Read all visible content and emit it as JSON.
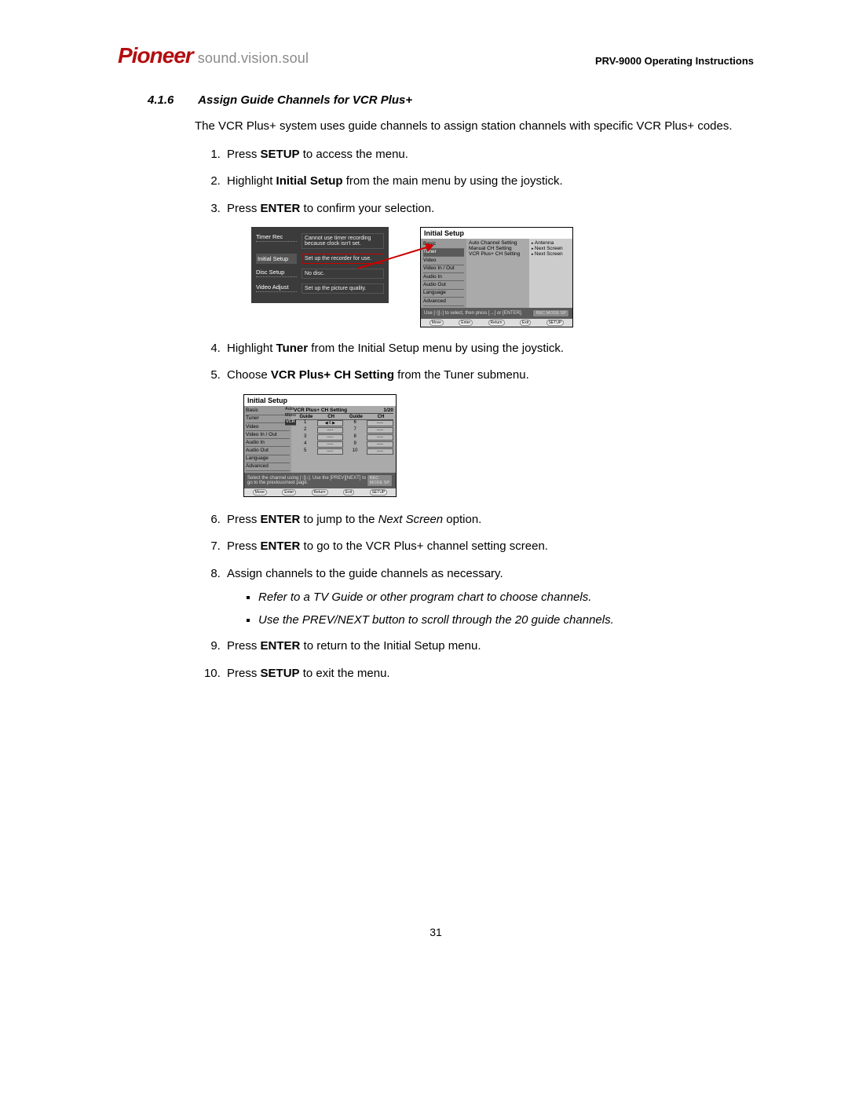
{
  "header": {
    "brand": "Pioneer",
    "tagline": "sound.vision.soul",
    "doc_title": "PRV-9000 Operating Instructions"
  },
  "section": {
    "number": "4.1.6",
    "title": "Assign Guide Channels for VCR Plus+"
  },
  "intro": "The VCR Plus+ system uses guide channels to assign station channels with specific VCR Plus+ codes.",
  "steps": {
    "s1_a": "Press ",
    "s1_b": "SETUP",
    "s1_c": " to access the menu.",
    "s2_a": "Highlight ",
    "s2_b": "Initial Setup",
    "s2_c": " from the main menu by using the joystick.",
    "s3_a": "Press ",
    "s3_b": "ENTER",
    "s3_c": " to confirm your selection.",
    "s4_a": "Highlight ",
    "s4_b": "Tuner",
    "s4_c": " from the Initial Setup menu by using the joystick.",
    "s5_a": "Choose ",
    "s5_b": "VCR Plus+ CH Setting",
    "s5_c": " from the Tuner submenu.",
    "s6_a": "Press ",
    "s6_b": "ENTER",
    "s6_c": " to jump to the ",
    "s6_d": "Next Screen",
    "s6_e": " option.",
    "s7_a": "Press ",
    "s7_b": "ENTER",
    "s7_c": " to go to the VCR Plus+ channel setting screen.",
    "s8": "Assign channels to the guide channels as necessary.",
    "s8_sub1": "Refer to a TV Guide or other program chart to choose channels.",
    "s8_sub2": "Use the PREV/NEXT button to scroll through the 20 guide channels.",
    "s9_a": "Press ",
    "s9_b": "ENTER",
    "s9_c": " to return to the Initial Setup menu.",
    "s10_a": "Press ",
    "s10_b": "SETUP",
    "s10_c": " to exit the menu."
  },
  "fig1": {
    "dark": {
      "r1_label": "Timer Rec",
      "r1_desc": "Cannot use timer recording because clock isn't set.",
      "r2_label": "Initial Setup",
      "r2_desc": "Set up the recorder for use.",
      "r3_label": "Disc Setup",
      "r3_desc": "No disc.",
      "r4_label": "Video Adjust",
      "r4_desc": "Set up the picture quality."
    },
    "light": {
      "title": "Initial Setup",
      "left": [
        "Basic",
        "Tuner",
        "Video",
        "Video In / Out",
        "Audio In",
        "Audio Out",
        "Language",
        "Advanced"
      ],
      "mid": [
        "Auto Channel Setting",
        "Manual CH Setting",
        "VCR Plus+ CH Setting"
      ],
      "right": [
        "Antenna",
        "Next Screen",
        "Next Screen"
      ],
      "hint": "Use [↑][↓] to select, then press [→] or [ENTER].",
      "badge": "REC MODE SP",
      "foot": [
        "Move",
        "Enter",
        "Return",
        "Exit",
        "SETUP"
      ]
    }
  },
  "fig2": {
    "title": "Initial Setup",
    "left": [
      "Basic",
      "Tuner",
      "Video",
      "Video In / Out",
      "Audio In",
      "Audio Out",
      "Language",
      "Advanced"
    ],
    "tags": [
      "Auto",
      "Manu",
      "VCR"
    ],
    "table_title": "VCR Plus+ CH Setting",
    "page": "1/20",
    "hd": [
      "Guide",
      "CH",
      "Guide",
      "CH"
    ],
    "rows": [
      [
        "1",
        "◀ 6 ▶",
        "6",
        "-----"
      ],
      [
        "2",
        "-----",
        "7",
        "-----"
      ],
      [
        "3",
        "-----",
        "8",
        "-----"
      ],
      [
        "4",
        "-----",
        "9",
        "-----"
      ],
      [
        "5",
        "-----",
        "10",
        "-----"
      ]
    ],
    "hint": "Select the channel using [↑][↓]. Use the [PREV][NEXT] to go to the previous/next page.",
    "badge": "REC MODE SP",
    "foot": [
      "Move",
      "Enter",
      "Return",
      "Exit",
      "SETUP"
    ]
  },
  "page_number": "31"
}
